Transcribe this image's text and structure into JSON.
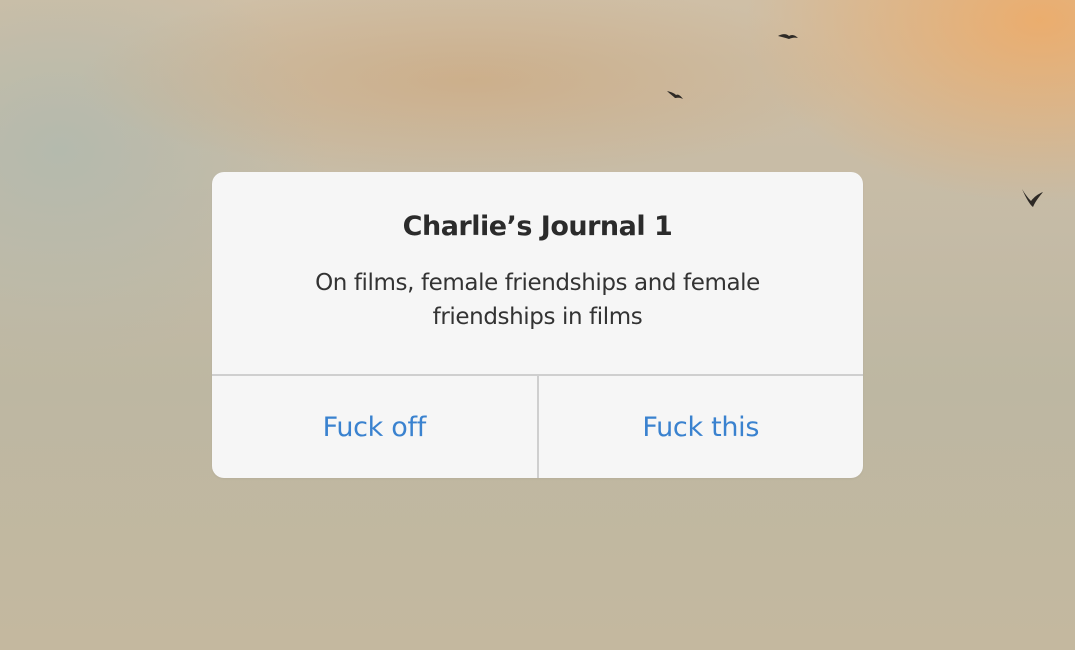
{
  "background": {
    "description_icons": [
      "bird-icon",
      "bird-icon",
      "bird-icon"
    ]
  },
  "dialog": {
    "title": "Charlie’s Journal 1",
    "message": "On films, female friendships and female friendships in films",
    "buttons": [
      {
        "label": "Fuck off"
      },
      {
        "label": "Fuck this"
      }
    ]
  },
  "colors": {
    "button_text": "#3a82cf",
    "dialog_background": "#f6f6f6",
    "divider": "#cfcfcf"
  }
}
